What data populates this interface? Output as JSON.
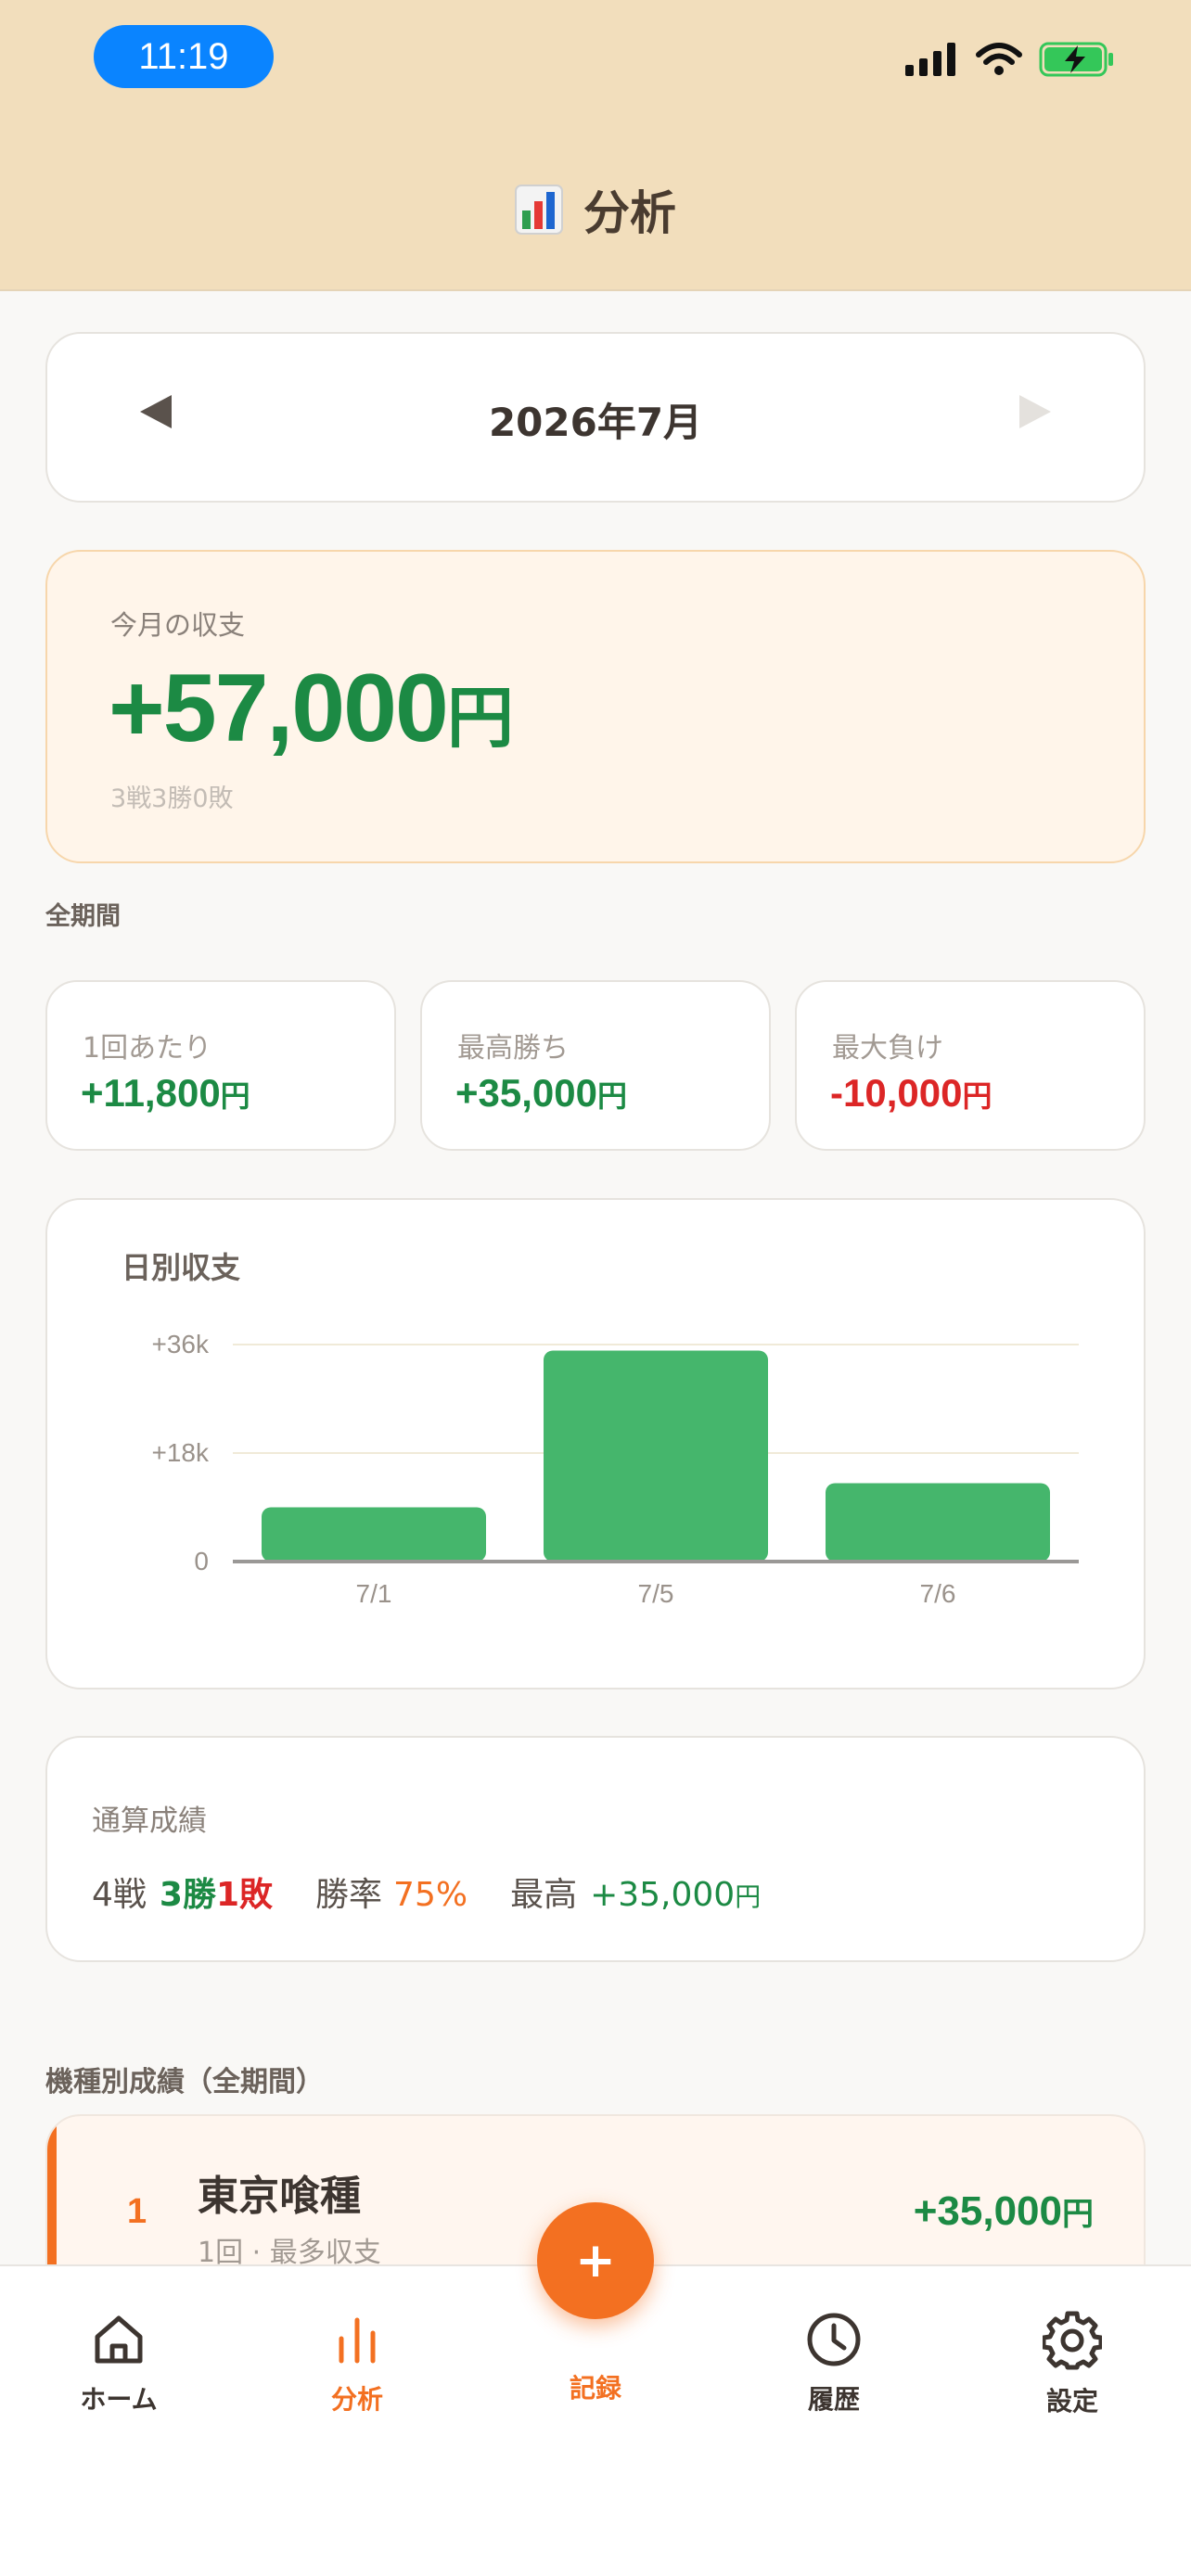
{
  "status_bar": {
    "time": "11:19"
  },
  "header": {
    "icon": "bar-chart-emoji",
    "title": "分析"
  },
  "month_nav": {
    "label": "2026年7月"
  },
  "summary": {
    "label": "今月の収支",
    "value": "+57,000",
    "unit": "円",
    "record": "3戦3勝0敗"
  },
  "all_period_label": "全期間",
  "stats": [
    {
      "label": "1回あたり",
      "value": "+11,800",
      "unit": "円",
      "tone": "pos"
    },
    {
      "label": "最高勝ち",
      "value": "+35,000",
      "unit": "円",
      "tone": "pos"
    },
    {
      "label": "最大負け",
      "value": "-10,000",
      "unit": "円",
      "tone": "neg"
    }
  ],
  "chart_data": {
    "type": "bar",
    "title": "日別収支",
    "categories": [
      "7/1",
      "7/5",
      "7/6"
    ],
    "values": [
      9000,
      35000,
      13000
    ],
    "y_ticks": [
      {
        "value": 36000,
        "label": "+36k"
      },
      {
        "value": 18000,
        "label": "+18k"
      },
      {
        "value": 0,
        "label": "0"
      }
    ],
    "ylim": [
      0,
      36000
    ],
    "bar_color": "#45b66c",
    "grid": true
  },
  "totals": {
    "title": "通算成績",
    "games": "4戦",
    "wins": "3勝",
    "losses": "1敗",
    "rate_label": "勝率",
    "rate_value": "75%",
    "best_label": "最高",
    "best_value": "+35,000",
    "best_unit": "円"
  },
  "machine_section_label": "機種別成績（全期間）",
  "machines": [
    {
      "rank": "1",
      "name": "東京喰種",
      "sub": "1回 · 最多収支",
      "value": "+35,000",
      "unit": "円"
    }
  ],
  "tabbar": {
    "home": "ホーム",
    "analysis": "分析",
    "record": "記録",
    "fab": "+",
    "history": "履歴",
    "settings": "設定"
  },
  "colors": {
    "accent": "#f37021",
    "positive": "#1c8a44",
    "negative": "#dc2626",
    "header_bg": "#f2debc"
  }
}
